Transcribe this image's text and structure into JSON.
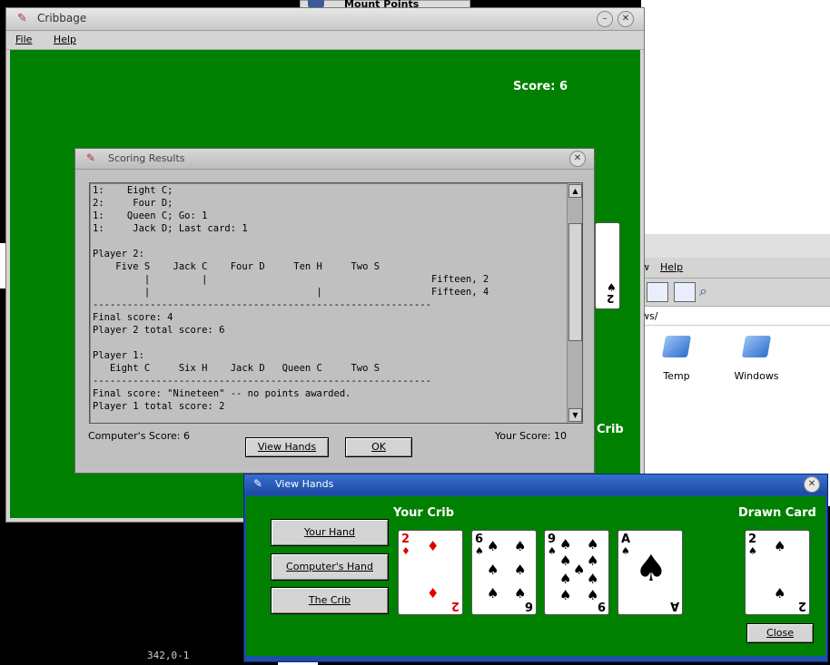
{
  "main_window": {
    "title": "Cribbage",
    "menu": [
      "File",
      "Help"
    ],
    "score_label": "Score: 6",
    "crib_label": "Crib"
  },
  "background": {
    "mount_points_title": "Mount Points",
    "fm_menu": [
      "w",
      "Help"
    ],
    "fm_path": "ws/",
    "folders": [
      "Temp",
      "Windows"
    ],
    "terminal_status": "342,0-1"
  },
  "scoring_dialog": {
    "title": "Scoring Results",
    "lines": [
      "1:    Eight C;",
      "2:     Four D;",
      "1:    Queen C; Go: 1",
      "1:     Jack D; Last card: 1",
      "",
      "Player 2:",
      "    Five S    Jack C    Four D     Ten H     Two S",
      "         |         |                                       Fifteen, 2",
      "         |                             |                   Fifteen, 4",
      "-----------------------------------------------------------",
      "Final score: 4",
      "Player 2 total score: 6",
      "",
      "Player 1:",
      "   Eight C     Six H    Jack D   Queen C     Two S",
      "-----------------------------------------------------------",
      "Final score: \"Nineteen\" -- no points awarded.",
      "Player 1 total score: 2"
    ],
    "computer_score": "Computer's Score: 6",
    "your_score": "Your Score: 10",
    "view_hands_button": "View Hands",
    "ok_button": "OK"
  },
  "view_hands": {
    "title": "View Hands",
    "buttons": [
      "Your Hand",
      "Computer's Hand",
      "The Crib"
    ],
    "crib_heading": "Your Crib",
    "drawn_heading": "Drawn Card",
    "close_button": "Close",
    "cards": [
      {
        "rank": "2",
        "suit": "♦",
        "color": "#e00000"
      },
      {
        "rank": "6",
        "suit": "♠",
        "color": "#000000"
      },
      {
        "rank": "9",
        "suit": "♠",
        "color": "#000000"
      },
      {
        "rank": "A",
        "suit": "♠",
        "color": "#000000"
      }
    ],
    "drawn_card": {
      "rank": "2",
      "suit": "♠",
      "color": "#000000"
    }
  },
  "colors": {
    "felt": "#008000",
    "dialog": "#c0c0c0"
  }
}
